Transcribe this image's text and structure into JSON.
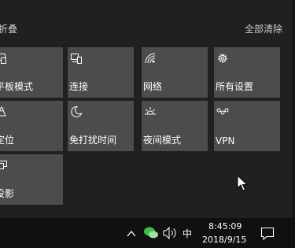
{
  "header": {
    "collapse_label": "折叠",
    "clear_all_label": "全部清除"
  },
  "tiles": [
    {
      "label": "平板模式",
      "icon": "tablet-mode-icon"
    },
    {
      "label": "连接",
      "icon": "connect-icon"
    },
    {
      "label": "网络",
      "icon": "network-icon"
    },
    {
      "label": "所有设置",
      "icon": "settings-gear-icon"
    },
    {
      "label": "定位",
      "icon": "location-icon"
    },
    {
      "label": "免打扰时间",
      "icon": "quiet-hours-moon-icon"
    },
    {
      "label": "夜间模式",
      "icon": "night-light-icon"
    },
    {
      "label": "VPN",
      "icon": "vpn-icon"
    },
    {
      "label": "投影",
      "icon": "project-icon"
    }
  ],
  "taskbar": {
    "ime_label": "中",
    "time": "8:45:09",
    "date": "2018/9/15"
  },
  "colors": {
    "tile_bg": "#4c4c4c",
    "panel_bg": "#202020",
    "taskbar_bg": "#101010",
    "wechat_green": "#3fbf3f"
  }
}
